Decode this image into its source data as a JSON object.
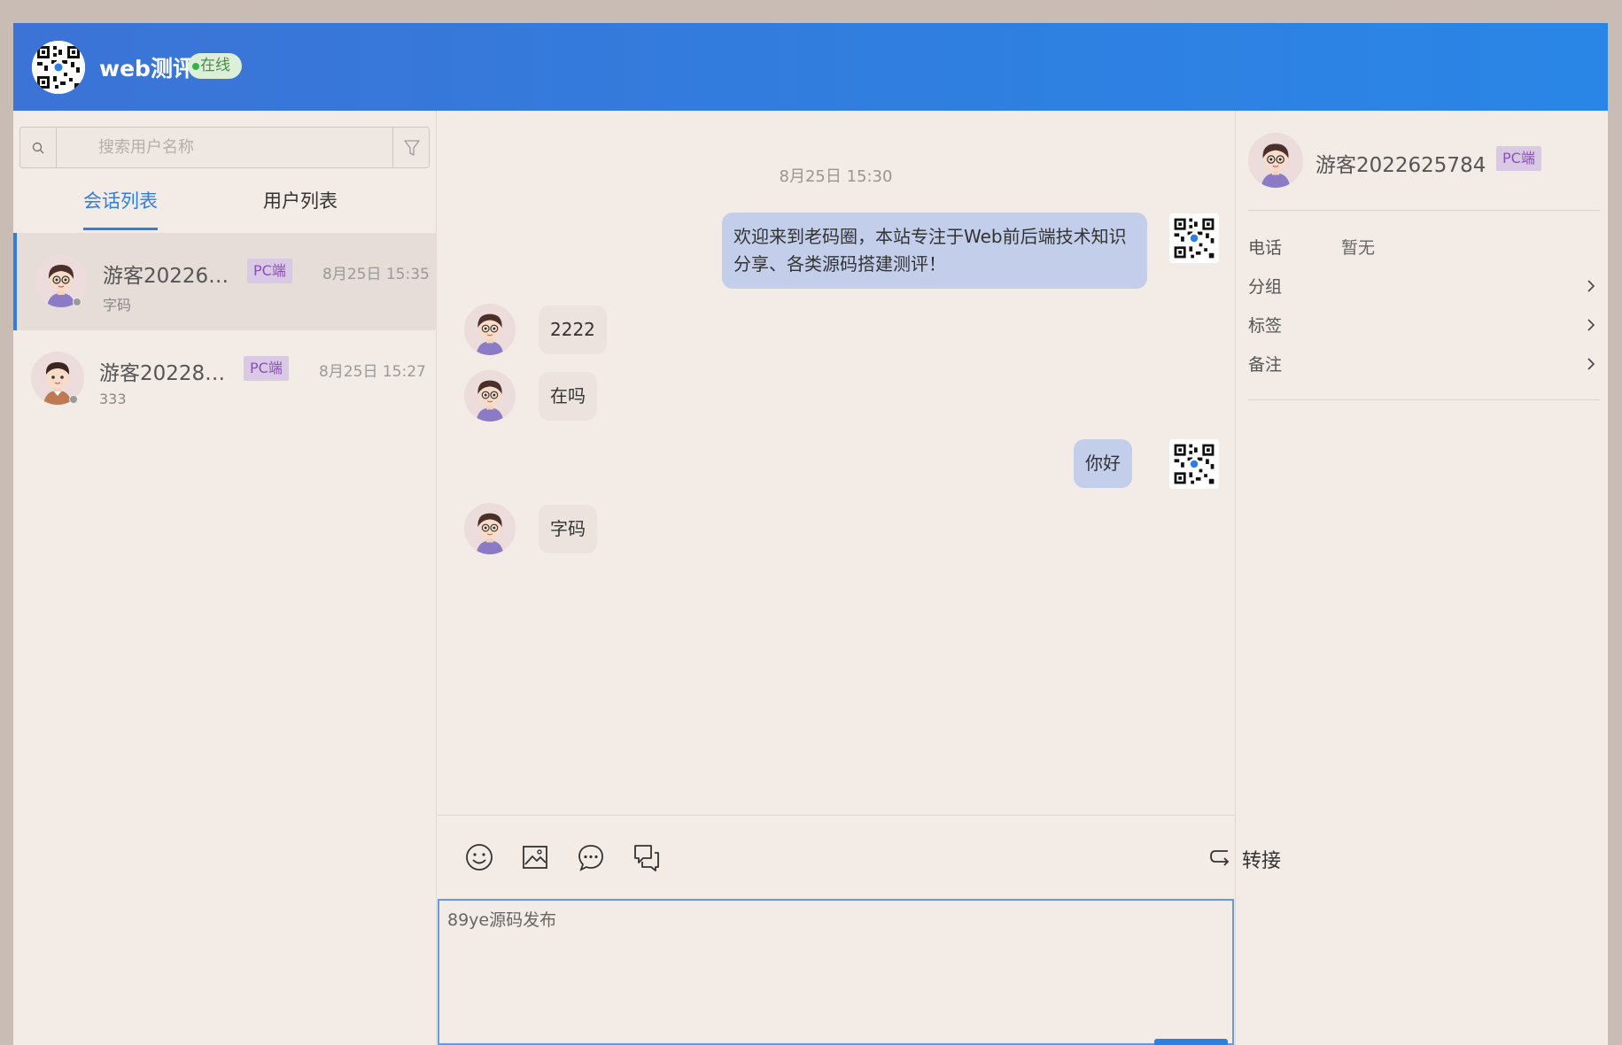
{
  "header": {
    "title": "web测评",
    "status": "在线"
  },
  "sidebar": {
    "search_placeholder": "搜索用户名称",
    "tabs": [
      {
        "label": "会话列表",
        "active": true
      },
      {
        "label": "用户列表",
        "active": false
      }
    ],
    "conversations": [
      {
        "name": "游客202262…",
        "tag": "PC端",
        "time": "8月25日 15:35",
        "preview": "字码",
        "active": true
      },
      {
        "name": "游客202283…",
        "tag": "PC端",
        "time": "8月25日 15:27",
        "preview": "333",
        "active": false
      }
    ]
  },
  "chat": {
    "timestamp": "8月25日 15:30",
    "messages": [
      {
        "from": "agent",
        "text": "欢迎来到老码圈，本站专注于Web前后端技术知识分享、各类源码搭建测评！"
      },
      {
        "from": "user",
        "text": "2222"
      },
      {
        "from": "user",
        "text": "在吗"
      },
      {
        "from": "agent",
        "text": "你好"
      },
      {
        "from": "user",
        "text": "字码"
      }
    ],
    "toolbar": {
      "icons": [
        "emoji-icon",
        "image-icon",
        "chat-bubble-icon",
        "history-icon"
      ],
      "transfer_label": "转接"
    },
    "input_value": "89ye源码发布"
  },
  "profile": {
    "name": "游客2022625784",
    "tag": "PC端",
    "rows": [
      {
        "key": "电话",
        "value": "暂无"
      },
      {
        "key": "分组",
        "value": ""
      },
      {
        "key": "标签",
        "value": ""
      },
      {
        "key": "备注",
        "value": ""
      }
    ]
  },
  "colors": {
    "header_gradient_start": "#3c73d6",
    "header_gradient_end": "#2a86e6",
    "accent": "#2f7fe0",
    "background": "#f3ebe6",
    "incoming_bubble": "#ece3de",
    "outgoing_bubble": "#c3ceea",
    "tag_bg": "#d9c9e4",
    "tag_text": "#8a4fb9",
    "online": "#35b34a"
  }
}
